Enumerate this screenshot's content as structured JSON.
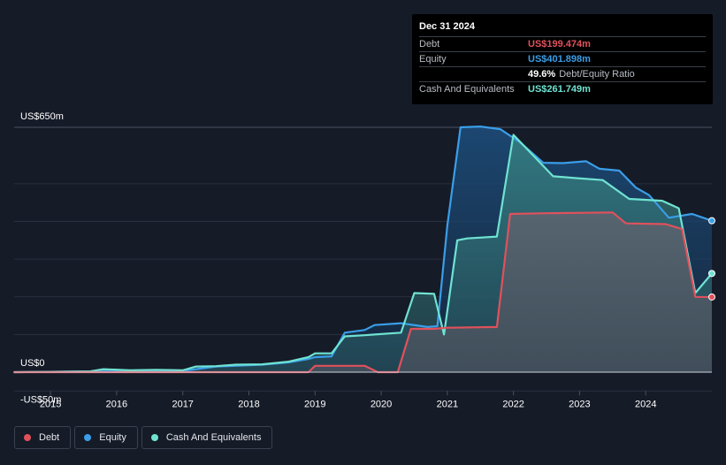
{
  "tooltip": {
    "date": "Dec 31 2024",
    "rows": [
      {
        "label": "Debt",
        "value": "US$199.474m",
        "color": "#e0515c"
      },
      {
        "label": "Equity",
        "value": "US$401.898m",
        "color": "#3a9ee8"
      },
      {
        "label": "",
        "value": "49.6%",
        "extra": "Debt/Equity Ratio",
        "color": "#ffffff"
      },
      {
        "label": "Cash And Equivalents",
        "value": "US$261.749m",
        "color": "#6fe3d2"
      }
    ]
  },
  "legend": {
    "items": [
      {
        "label": "Debt",
        "color": "#e0515c"
      },
      {
        "label": "Equity",
        "color": "#3a9ee8"
      },
      {
        "label": "Cash And Equivalents",
        "color": "#6fe3d2"
      }
    ]
  },
  "chart_data": {
    "type": "area",
    "x_unit": "year",
    "y_unit": "US$m",
    "ylim": [
      -50,
      650
    ],
    "y_tick_labels": [
      {
        "value": 650,
        "label": "US$650m"
      },
      {
        "value": 0,
        "label": "US$0"
      },
      {
        "value": -50,
        "label": "-US$50m"
      }
    ],
    "x_ticks": [
      2015,
      2016,
      2017,
      2018,
      2019,
      2020,
      2021,
      2022,
      2023,
      2024
    ],
    "xlim": [
      2014.45,
      2025.0
    ],
    "grid": true,
    "legend_position": "bottom-left",
    "series": [
      {
        "name": "Equity",
        "color": "#3a9ee8",
        "points": [
          [
            2014.45,
            0
          ],
          [
            2015.0,
            1
          ],
          [
            2015.6,
            2
          ],
          [
            2015.8,
            5
          ],
          [
            2016.2,
            3
          ],
          [
            2016.6,
            4
          ],
          [
            2017.0,
            3
          ],
          [
            2017.2,
            8
          ],
          [
            2017.5,
            15
          ],
          [
            2017.8,
            17
          ],
          [
            2018.2,
            20
          ],
          [
            2018.6,
            26
          ],
          [
            2018.9,
            35
          ],
          [
            2019.0,
            40
          ],
          [
            2019.25,
            42
          ],
          [
            2019.45,
            105
          ],
          [
            2019.75,
            112
          ],
          [
            2019.9,
            125
          ],
          [
            2020.3,
            130
          ],
          [
            2020.7,
            120
          ],
          [
            2020.85,
            122
          ],
          [
            2021.0,
            390
          ],
          [
            2021.2,
            650
          ],
          [
            2021.5,
            652
          ],
          [
            2021.8,
            645
          ],
          [
            2022.1,
            610
          ],
          [
            2022.45,
            556
          ],
          [
            2022.75,
            555
          ],
          [
            2023.1,
            560
          ],
          [
            2023.3,
            540
          ],
          [
            2023.6,
            535
          ],
          [
            2023.85,
            490
          ],
          [
            2024.05,
            470
          ],
          [
            2024.35,
            410
          ],
          [
            2024.7,
            420
          ],
          [
            2025.0,
            402
          ]
        ]
      },
      {
        "name": "Cash And Equivalents",
        "color": "#6fe3d2",
        "points": [
          [
            2014.45,
            0
          ],
          [
            2015.0,
            1
          ],
          [
            2015.6,
            2
          ],
          [
            2015.8,
            8
          ],
          [
            2016.2,
            5
          ],
          [
            2016.6,
            6
          ],
          [
            2017.0,
            5
          ],
          [
            2017.2,
            15
          ],
          [
            2017.5,
            16
          ],
          [
            2017.8,
            20
          ],
          [
            2018.2,
            21
          ],
          [
            2018.6,
            28
          ],
          [
            2018.9,
            40
          ],
          [
            2019.0,
            50
          ],
          [
            2019.25,
            50
          ],
          [
            2019.45,
            95
          ],
          [
            2019.75,
            98
          ],
          [
            2019.9,
            100
          ],
          [
            2020.3,
            105
          ],
          [
            2020.5,
            210
          ],
          [
            2020.8,
            208
          ],
          [
            2020.95,
            100
          ],
          [
            2021.15,
            350
          ],
          [
            2021.3,
            355
          ],
          [
            2021.75,
            360
          ],
          [
            2022.0,
            630
          ],
          [
            2022.3,
            575
          ],
          [
            2022.6,
            520
          ],
          [
            2022.95,
            515
          ],
          [
            2023.35,
            510
          ],
          [
            2023.75,
            460
          ],
          [
            2024.25,
            455
          ],
          [
            2024.5,
            435
          ],
          [
            2024.75,
            210
          ],
          [
            2025.0,
            262
          ]
        ]
      },
      {
        "name": "Debt",
        "color": "#e0515c",
        "points": [
          [
            2014.45,
            0
          ],
          [
            2018.9,
            0
          ],
          [
            2019.0,
            17
          ],
          [
            2019.75,
            17
          ],
          [
            2019.95,
            0
          ],
          [
            2020.25,
            0
          ],
          [
            2020.45,
            115
          ],
          [
            2020.8,
            115
          ],
          [
            2021.0,
            118
          ],
          [
            2021.75,
            120
          ],
          [
            2021.95,
            420
          ],
          [
            2022.5,
            422
          ],
          [
            2023.5,
            424
          ],
          [
            2023.7,
            395
          ],
          [
            2024.3,
            393
          ],
          [
            2024.55,
            380
          ],
          [
            2024.75,
            200
          ],
          [
            2025.0,
            199.5
          ]
        ]
      }
    ]
  }
}
